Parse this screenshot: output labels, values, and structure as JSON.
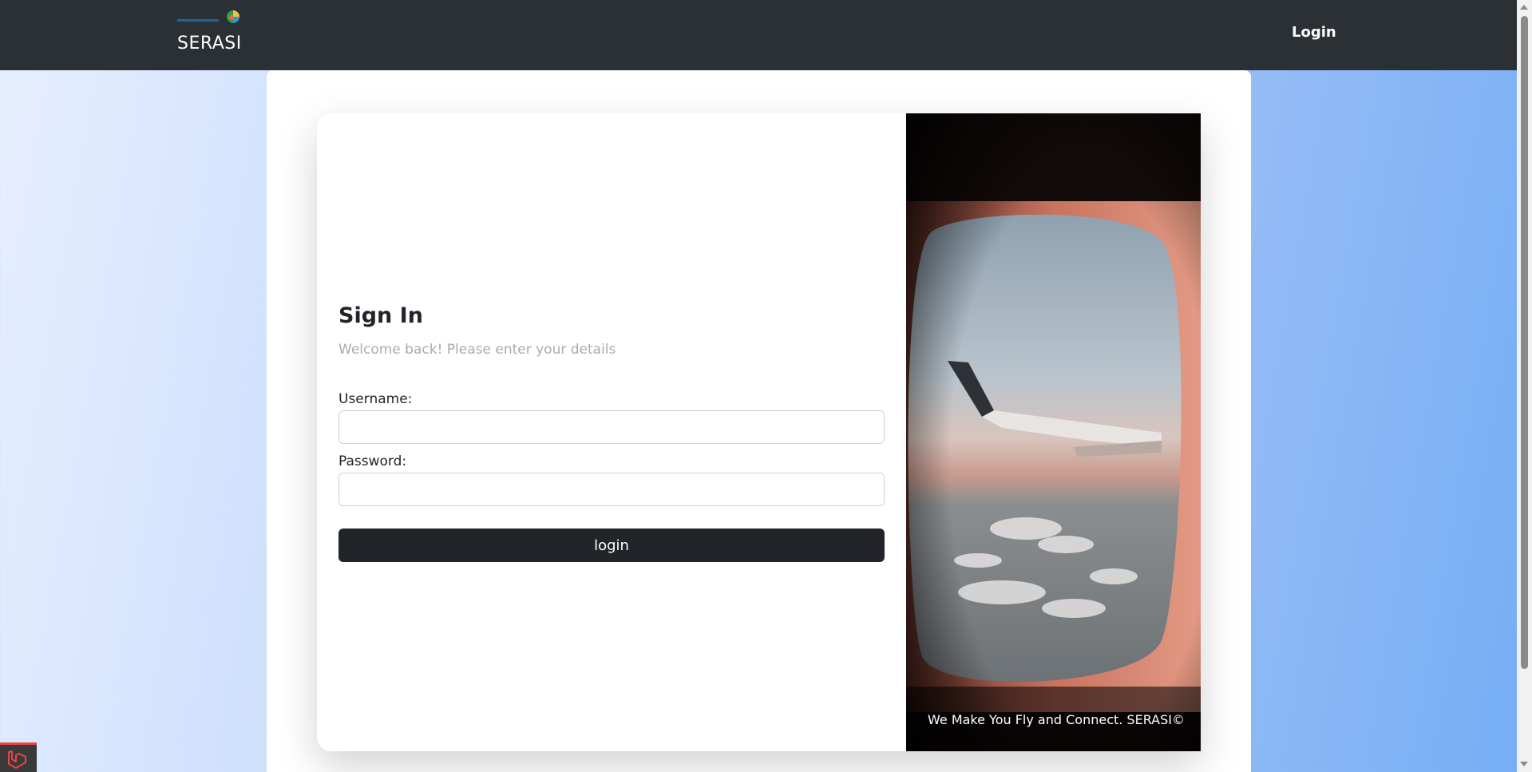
{
  "navbar": {
    "brand_name": "SERASI",
    "login_link": "Login",
    "background": "#2b3035"
  },
  "login_form": {
    "title": "Sign In",
    "subtitle": "Welcome back! Please enter your details",
    "username_label": "Username:",
    "username_value": "",
    "password_label": "Password:",
    "password_value": "",
    "submit_label": "login",
    "button_color": "#212529"
  },
  "image_panel": {
    "icon": "airplane-window-photo",
    "caption": "We Make You Fly and Connect. SERASI©"
  },
  "debug_badge": {
    "icon": "laravel-logo-icon"
  }
}
